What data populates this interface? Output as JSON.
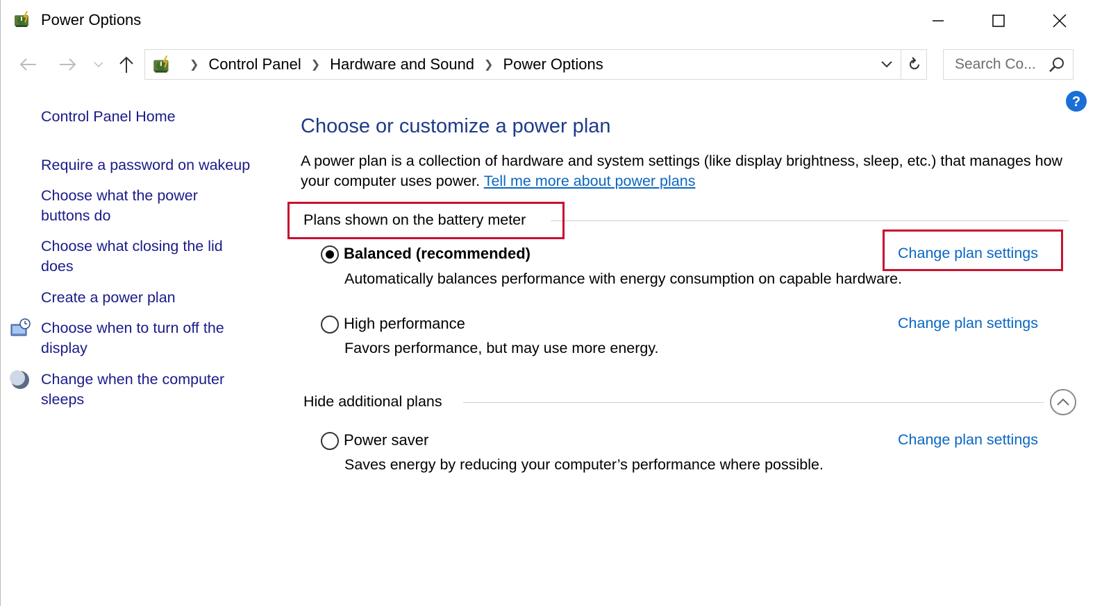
{
  "window": {
    "title": "Power Options",
    "icon": "power-options-icon"
  },
  "titlebar_buttons": {
    "minimize": "minimize-icon",
    "maximize": "maximize-icon",
    "close": "close-icon"
  },
  "nav": {
    "back": "back-arrow-icon",
    "forward": "forward-arrow-icon",
    "recent": "chevron-down-icon",
    "up": "up-arrow-icon"
  },
  "address": {
    "breadcrumbs": [
      "Control Panel",
      "Hardware and Sound",
      "Power Options"
    ]
  },
  "search": {
    "placeholder": "Search Co..."
  },
  "sidebar": {
    "home": "Control Panel Home",
    "items": [
      {
        "label": "Require a password on wakeup",
        "icon": null
      },
      {
        "label": "Choose what the power buttons do",
        "icon": null
      },
      {
        "label": "Choose what closing the lid does",
        "icon": null
      },
      {
        "label": "Create a power plan",
        "icon": null
      },
      {
        "label": "Choose when to turn off the display",
        "icon": "display-clock-icon"
      },
      {
        "label": "Change when the computer sleeps",
        "icon": "moon-icon"
      }
    ]
  },
  "main": {
    "heading": "Choose or customize a power plan",
    "description": "A power plan is a collection of hardware and system settings (like display brightness, sleep, etc.) that manages how your computer uses power. ",
    "description_link": "Tell me more about power plans",
    "battery_group_label": "Plans shown on the battery meter",
    "additional_group_label": "Hide additional plans",
    "plans": [
      {
        "name": "Balanced (recommended)",
        "description": "Automatically balances performance with energy consumption on capable hardware.",
        "selected": true,
        "change_label": "Change plan settings"
      },
      {
        "name": "High performance",
        "description": "Favors performance, but may use more energy.",
        "selected": false,
        "change_label": "Change plan settings"
      },
      {
        "name": "Power saver",
        "description": "Saves energy by reducing your computer’s performance where possible.",
        "selected": false,
        "change_label": "Change plan settings"
      }
    ]
  },
  "colors": {
    "heading": "#1e3b8a",
    "link": "#0b66c2",
    "nav_link": "#1a1a8a",
    "highlight": "#c8102e"
  }
}
